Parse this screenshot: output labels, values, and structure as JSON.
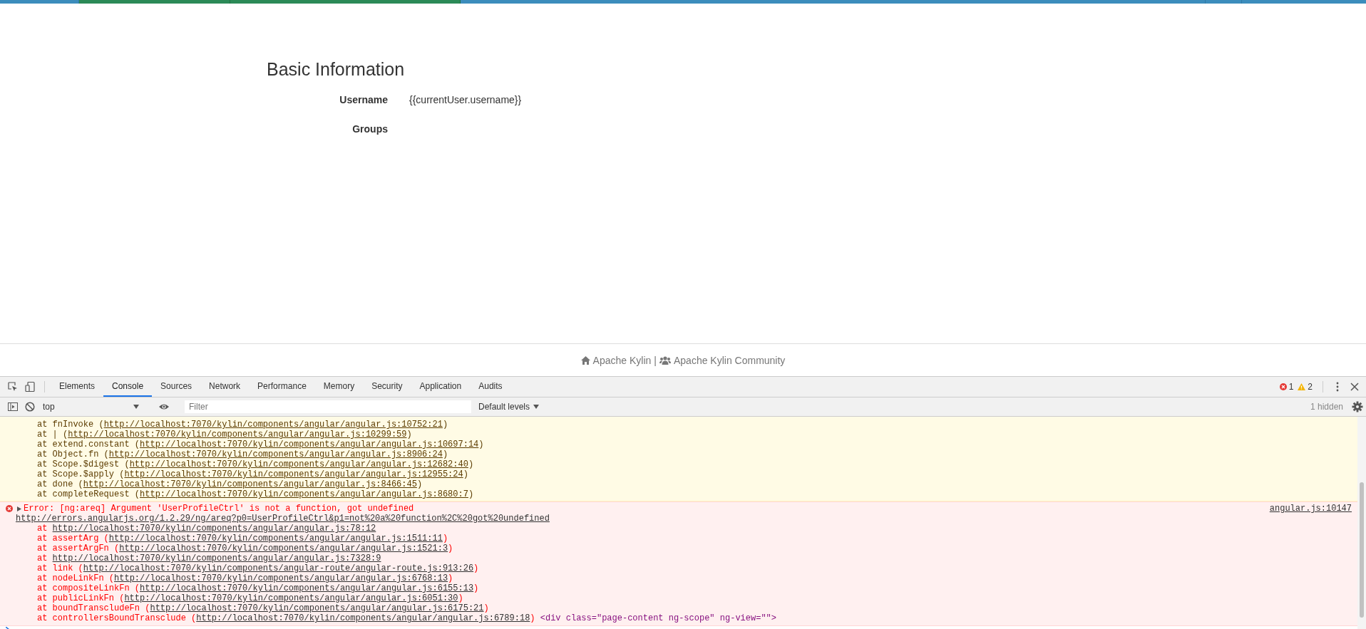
{
  "profile": {
    "title": "Basic Information",
    "fields": [
      {
        "label": "Username",
        "value": "{{currentUser.username}}"
      },
      {
        "label": "Groups"
      }
    ]
  },
  "footer": {
    "links": [
      {
        "kind": "home",
        "text": "Apache Kylin"
      },
      {
        "kind": "users",
        "text": "Apache Kylin Community"
      }
    ],
    "separator": "|"
  },
  "devtools": {
    "tabs": [
      {
        "label": "Elements",
        "selected": false
      },
      {
        "label": "Console",
        "selected": true
      },
      {
        "label": "Sources",
        "selected": false
      },
      {
        "label": "Network",
        "selected": false
      },
      {
        "label": "Performance",
        "selected": false
      },
      {
        "label": "Memory",
        "selected": false
      },
      {
        "label": "Security",
        "selected": false
      },
      {
        "label": "Application",
        "selected": false
      },
      {
        "label": "Audits",
        "selected": false
      }
    ],
    "error_count": "1",
    "warning_count": "2",
    "context": "top",
    "filter_placeholder": "Filter",
    "levels": "Default levels",
    "hidden": "1 hidden",
    "messages": [
      {
        "kind": "warning",
        "lines": [
          {
            "text": "at fnInvoke (",
            "link": "http://localhost:7070/kylin/components/angular/angular.js:10752:21",
            "end": ")"
          },
          {
            "text": "at | (",
            "link": "http://localhost:7070/kylin/components/angular/angular.js:10299:59",
            "end": ")"
          },
          {
            "text": "at extend.constant (",
            "link": "http://localhost:7070/kylin/components/angular/angular.js:10697:14",
            "end": ")"
          },
          {
            "text": "at Object.fn (",
            "link": "http://localhost:7070/kylin/components/angular/angular.js:8906:24",
            "end": ")"
          },
          {
            "text": "at Scope.$digest (",
            "link": "http://localhost:7070/kylin/components/angular/angular.js:12682:40",
            "end": ")"
          },
          {
            "text": "at Scope.$apply (",
            "link": "http://localhost:7070/kylin/components/angular/angular.js:12955:24",
            "end": ")"
          },
          {
            "text": "at done (",
            "link": "http://localhost:7070/kylin/components/angular/angular.js:8466:45",
            "end": ")"
          },
          {
            "text": "at completeRequest (",
            "link": "http://localhost:7070/kylin/components/angular/angular.js:8680:7",
            "end": ")"
          }
        ]
      },
      {
        "kind": "error",
        "title": "Error: [ng:areq] Argument 'UserProfileCtrl' is not a function, got undefined",
        "source": "angular.js:10147",
        "url": "http://errors.angularjs.org/1.2.29/ng/areq?p0=UserProfileCtrl&p1=not%20a%20function%2C%20got%20undefined",
        "lines": [
          {
            "text": "at ",
            "link": "http://localhost:7070/kylin/components/angular/angular.js:78:12"
          },
          {
            "text": "at assertArg (",
            "link": "http://localhost:7070/kylin/components/angular/angular.js:1511:11",
            "end": ")"
          },
          {
            "text": "at assertArgFn (",
            "link": "http://localhost:7070/kylin/components/angular/angular.js:1521:3",
            "end": ")"
          },
          {
            "text": "at ",
            "link": "http://localhost:7070/kylin/components/angular/angular.js:7328:9"
          },
          {
            "text": "at link (",
            "link": "http://localhost:7070/kylin/components/angular-route/angular-route.js:913:26",
            "end": ")"
          },
          {
            "text": "at nodeLinkFn (",
            "link": "http://localhost:7070/kylin/components/angular/angular.js:6768:13",
            "end": ")"
          },
          {
            "text": "at compositeLinkFn (",
            "link": "http://localhost:7070/kylin/components/angular/angular.js:6155:13",
            "end": ")"
          },
          {
            "text": "at publicLinkFn (",
            "link": "http://localhost:7070/kylin/components/angular/angular.js:6051:30",
            "end": ")"
          },
          {
            "text": "at boundTranscludeFn (",
            "link": "http://localhost:7070/kylin/components/angular/angular.js:6175:21",
            "end": ")"
          },
          {
            "text": "at controllersBoundTransclude (",
            "link": "http://localhost:7070/kylin/components/angular/angular.js:6789:18",
            "end": ")",
            "extra": "<div class=\"page-content ng-scope\" ng-view=\"\">"
          }
        ]
      }
    ]
  }
}
